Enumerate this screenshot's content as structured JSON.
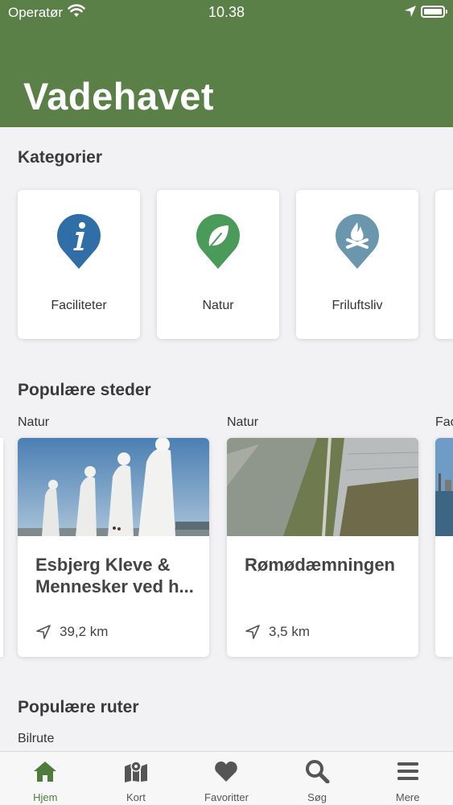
{
  "status_bar": {
    "carrier": "Operatør",
    "time": "10.38"
  },
  "header": {
    "title": "Vadehavet",
    "color": "#5b8047"
  },
  "categories": {
    "title": "Kategorier",
    "items": [
      {
        "label": "Faciliteter",
        "icon": "info-pin-icon",
        "color": "#2f6ea6"
      },
      {
        "label": "Natur",
        "icon": "leaf-pin-icon",
        "color": "#4a9a5a"
      },
      {
        "label": "Friluftsliv",
        "icon": "campfire-pin-icon",
        "color": "#6a97ad"
      }
    ]
  },
  "popular_places": {
    "title": "Populære steder",
    "items": [
      {
        "category": "Natur",
        "name": "Esbjerg Kleve & Mennesker ved h...",
        "distance": "39,2 km"
      },
      {
        "category": "Natur",
        "name": "Rømødæmningen",
        "distance": "3,5 km"
      },
      {
        "category": "Fac"
      }
    ]
  },
  "popular_routes": {
    "title": "Populære ruter",
    "first_category": "Bilrute"
  },
  "tabbar": {
    "items": [
      {
        "label": "Hjem",
        "icon": "home-icon",
        "active": true
      },
      {
        "label": "Kort",
        "icon": "map-icon",
        "active": false
      },
      {
        "label": "Favoritter",
        "icon": "heart-icon",
        "active": false
      },
      {
        "label": "Søg",
        "icon": "search-icon",
        "active": false
      },
      {
        "label": "Mere",
        "icon": "menu-icon",
        "active": false
      }
    ],
    "active_color": "#4e7c3c"
  }
}
